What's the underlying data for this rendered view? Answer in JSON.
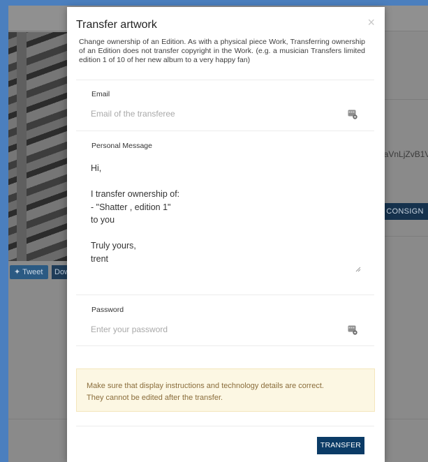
{
  "background": {
    "tweet_label": "Tweet",
    "download_label": "Dow",
    "hash_fragment": "?aVnLjZvB1V",
    "consign_label": "CONSIGN"
  },
  "modal": {
    "title": "Transfer artwork",
    "close_glyph": "×",
    "description": "Change ownership of an Edition. As with a physical piece Work, Transferring ownership of an Edition does not transfer copyright in the Work. (e.g. a musician Transfers limited edition 1 of 10 of her new album to a very happy fan)",
    "email": {
      "label": "Email",
      "placeholder": "Email of the transferee",
      "value": ""
    },
    "message": {
      "label": "Personal Message",
      "value": "Hi,\n\nI transfer ownership of:\n- \"Shatter , edition 1\"\nto you\n\nTruly yours,\ntrent"
    },
    "password": {
      "label": "Password",
      "placeholder": "Enter your password",
      "value": ""
    },
    "warning": {
      "line1": "Make sure that display instructions and technology details are correct.",
      "line2": "They cannot be edited after the transfer."
    },
    "submit_label": "TRANSFER",
    "icons": {
      "field_icon": "password-manager-icon"
    },
    "colors": {
      "button": "#0b3b66",
      "warning_bg": "#fcf7e3",
      "warning_text": "#8a6d3b"
    }
  }
}
